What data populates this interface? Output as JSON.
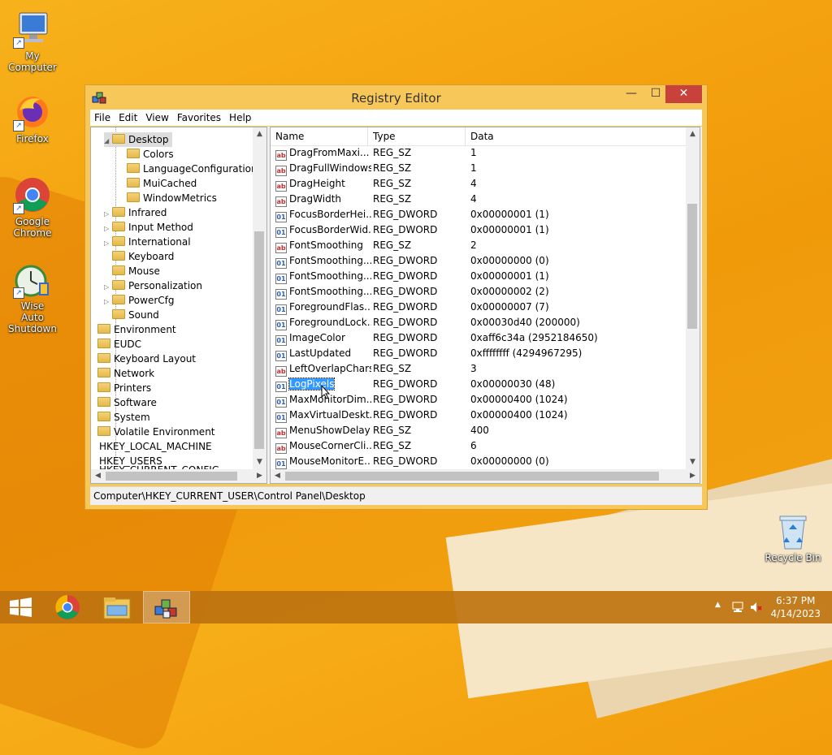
{
  "desktop": {
    "icons": [
      {
        "label": "My Computer",
        "icon": "computer-icon"
      },
      {
        "label": "Firefox",
        "icon": "firefox-icon"
      },
      {
        "label": "Google Chrome",
        "icon": "chrome-icon"
      },
      {
        "label": "Wise Auto Shutdown",
        "icon": "shutdown-clock-icon"
      },
      {
        "label": "Recycle Bin",
        "icon": "recycle-bin-icon"
      }
    ]
  },
  "window": {
    "title": "Registry Editor",
    "controls": {
      "minimize": "—",
      "maximize": "☐",
      "close": "✕"
    },
    "menu": [
      "File",
      "Edit",
      "View",
      "Favorites",
      "Help"
    ],
    "tree": [
      {
        "label": "Desktop",
        "expand": "◢"
      },
      {
        "label": "Colors",
        "expand": ""
      },
      {
        "label": "LanguageConfiguration",
        "expand": ""
      },
      {
        "label": "MuiCached",
        "expand": ""
      },
      {
        "label": "WindowMetrics",
        "expand": ""
      },
      {
        "label": "Infrared",
        "expand": "▷"
      },
      {
        "label": "Input Method",
        "expand": "▷"
      },
      {
        "label": "International",
        "expand": "▷"
      },
      {
        "label": "Keyboard",
        "expand": ""
      },
      {
        "label": "Mouse",
        "expand": ""
      },
      {
        "label": "Personalization",
        "expand": "▷"
      },
      {
        "label": "PowerCfg",
        "expand": "▷"
      },
      {
        "label": "Sound",
        "expand": ""
      },
      {
        "label": "Environment",
        "expand": ""
      },
      {
        "label": "EUDC",
        "expand": ""
      },
      {
        "label": "Keyboard Layout",
        "expand": ""
      },
      {
        "label": "Network",
        "expand": ""
      },
      {
        "label": "Printers",
        "expand": ""
      },
      {
        "label": "Software",
        "expand": ""
      },
      {
        "label": "System",
        "expand": ""
      },
      {
        "label": "Volatile Environment",
        "expand": ""
      },
      {
        "label": "HKEY_LOCAL_MACHINE",
        "expand": ""
      },
      {
        "label": "HKEY_USERS",
        "expand": ""
      },
      {
        "label": "HKEY_CURRENT_CONFIG",
        "expand": ""
      }
    ],
    "columns": [
      "Name",
      "Type",
      "Data"
    ],
    "values": [
      {
        "icon": "ab",
        "name": "DragFromMaxi...",
        "type": "REG_SZ",
        "data": "1"
      },
      {
        "icon": "ab",
        "name": "DragFullWindows",
        "type": "REG_SZ",
        "data": "1"
      },
      {
        "icon": "ab",
        "name": "DragHeight",
        "type": "REG_SZ",
        "data": "4"
      },
      {
        "icon": "ab",
        "name": "DragWidth",
        "type": "REG_SZ",
        "data": "4"
      },
      {
        "icon": "01",
        "name": "FocusBorderHei...",
        "type": "REG_DWORD",
        "data": "0x00000001 (1)"
      },
      {
        "icon": "01",
        "name": "FocusBorderWid...",
        "type": "REG_DWORD",
        "data": "0x00000001 (1)"
      },
      {
        "icon": "ab",
        "name": "FontSmoothing",
        "type": "REG_SZ",
        "data": "2"
      },
      {
        "icon": "01",
        "name": "FontSmoothing...",
        "type": "REG_DWORD",
        "data": "0x00000000 (0)"
      },
      {
        "icon": "01",
        "name": "FontSmoothing...",
        "type": "REG_DWORD",
        "data": "0x00000001 (1)"
      },
      {
        "icon": "01",
        "name": "FontSmoothing...",
        "type": "REG_DWORD",
        "data": "0x00000002 (2)"
      },
      {
        "icon": "01",
        "name": "ForegroundFlas...",
        "type": "REG_DWORD",
        "data": "0x00000007 (7)"
      },
      {
        "icon": "01",
        "name": "ForegroundLock...",
        "type": "REG_DWORD",
        "data": "0x00030d40 (200000)"
      },
      {
        "icon": "01",
        "name": "ImageColor",
        "type": "REG_DWORD",
        "data": "0xaff6c34a (2952184650)"
      },
      {
        "icon": "01",
        "name": "LastUpdated",
        "type": "REG_DWORD",
        "data": "0xffffffff (4294967295)"
      },
      {
        "icon": "ab",
        "name": "LeftOverlapChars",
        "type": "REG_SZ",
        "data": "3"
      },
      {
        "icon": "01",
        "name": "LogPixels",
        "type": "REG_DWORD",
        "data": "0x00000030 (48)",
        "selected": true
      },
      {
        "icon": "01",
        "name": "MaxMonitorDim...",
        "type": "REG_DWORD",
        "data": "0x00000400 (1024)"
      },
      {
        "icon": "01",
        "name": "MaxVirtualDeskt...",
        "type": "REG_DWORD",
        "data": "0x00000400 (1024)"
      },
      {
        "icon": "ab",
        "name": "MenuShowDelay",
        "type": "REG_SZ",
        "data": "400"
      },
      {
        "icon": "ab",
        "name": "MouseCornerCli...",
        "type": "REG_SZ",
        "data": "6"
      },
      {
        "icon": "01",
        "name": "MouseMonitorE...",
        "type": "REG_DWORD",
        "data": "0x00000000 (0)"
      }
    ],
    "status": "Computer\\HKEY_CURRENT_USER\\Control Panel\\Desktop"
  },
  "taskbar": {
    "buttons": [
      {
        "icon": "windows-logo-icon"
      },
      {
        "icon": "chrome-icon"
      },
      {
        "icon": "file-explorer-icon"
      },
      {
        "icon": "registry-editor-icon",
        "active": true
      }
    ],
    "tray": {
      "time": "6:37 PM",
      "date": "4/14/2023",
      "chevron": "▲"
    }
  }
}
